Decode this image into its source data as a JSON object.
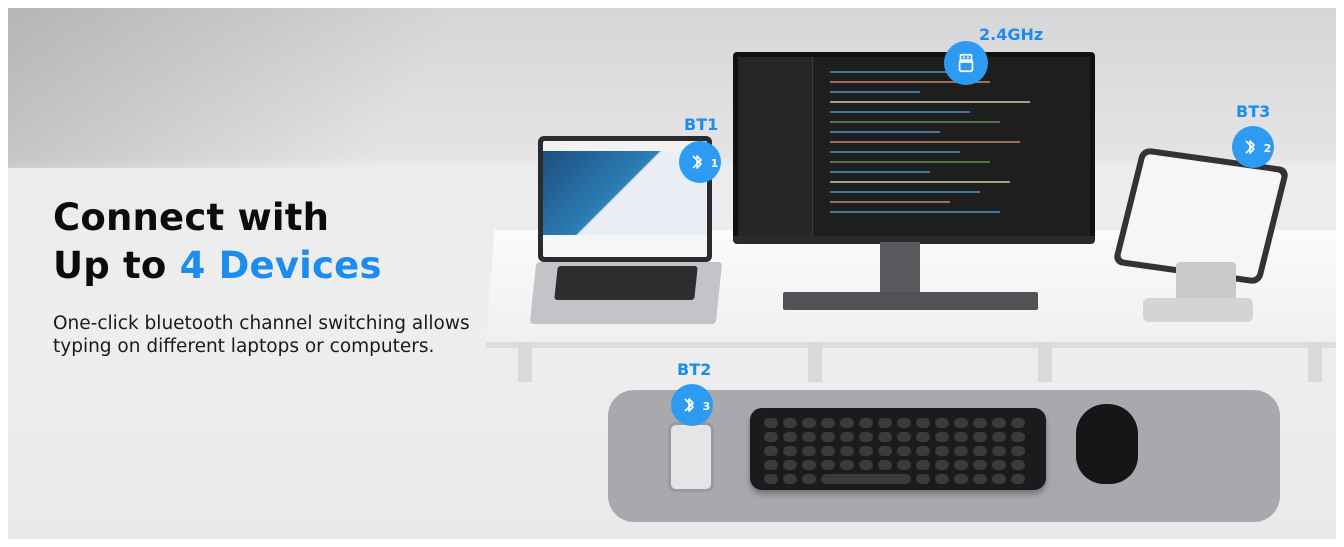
{
  "headline": {
    "line1": "Connect with",
    "line2_prefix": "Up to ",
    "line2_accent": "4 Devices"
  },
  "subtext": "One-click bluetooth channel switching allows typing on different laptops or computers.",
  "channels": [
    {
      "label": "BT1",
      "icon": "bluetooth-icon",
      "number": "1",
      "device": "laptop"
    },
    {
      "label": "2.4GHz",
      "icon": "usb-receiver-icon",
      "device": "monitor"
    },
    {
      "label": "BT3",
      "icon": "bluetooth-icon",
      "number": "2",
      "device": "tablet"
    },
    {
      "label": "BT2",
      "icon": "bluetooth-icon",
      "number": "3",
      "device": "phone"
    }
  ],
  "colors": {
    "accent": "#1b8cf0",
    "badge": "#2e9bf2",
    "text": "#0c0c0c"
  }
}
